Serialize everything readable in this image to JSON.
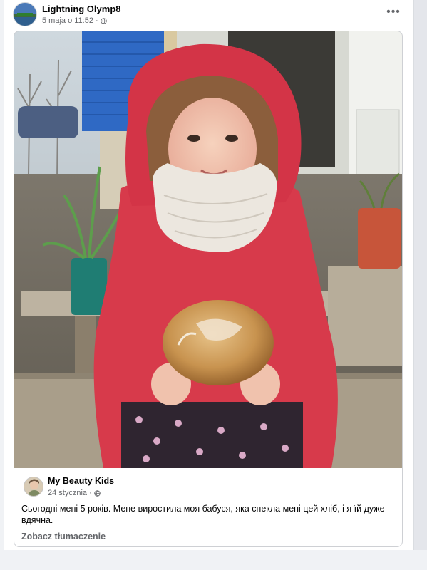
{
  "post": {
    "author": "Lightning Olymp8",
    "timestamp": "5 maja o 11:52",
    "separator": "·",
    "privacy_icon": "globe-icon",
    "more_icon": "more-options-icon",
    "more_label": "•••"
  },
  "shared_post": {
    "author": "My Beauty Kids",
    "timestamp": "24 stycznia",
    "separator": "·",
    "privacy_icon": "globe-icon",
    "text": "Сьогодні мені 5 років. Мене виростила моя бабуся, яка спекла мені цей хліб, і я їй дуже вдячна.",
    "translate_label": "Zobacz tłumaczenie"
  },
  "colors": {
    "secondary_text": "#65676b",
    "primary_text": "#050505",
    "card_border": "#ced0d4"
  }
}
